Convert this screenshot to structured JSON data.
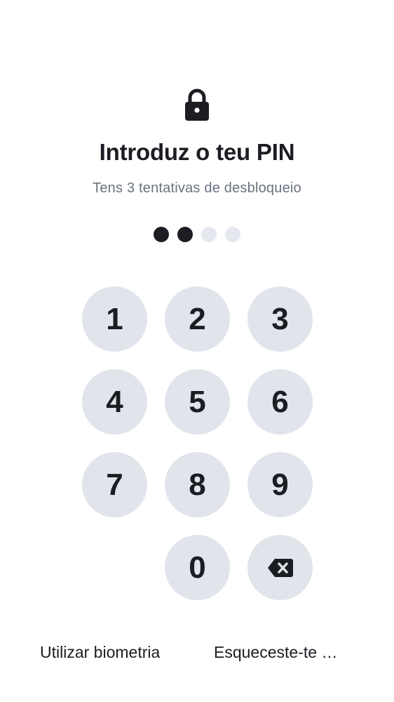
{
  "header": {
    "lock_icon": "lock-icon",
    "title": "Introduz o teu PIN",
    "subtitle": "Tens 3 tentativas de desbloqueio"
  },
  "pin": {
    "length": 4,
    "entered": 2
  },
  "keypad": {
    "keys": [
      "1",
      "2",
      "3",
      "4",
      "5",
      "6",
      "7",
      "8",
      "9",
      "",
      "0"
    ],
    "backspace_icon": "backspace-icon"
  },
  "footer": {
    "biometrics_label": "Utilizar biometria",
    "forgot_label": "Esqueceste-te …"
  },
  "colors": {
    "text": "#1b1d22",
    "subtitle": "#6b7280",
    "key_background": "#e1e5eb",
    "dot_empty": "#e5e8ee",
    "dot_filled": "#1b1d22"
  }
}
